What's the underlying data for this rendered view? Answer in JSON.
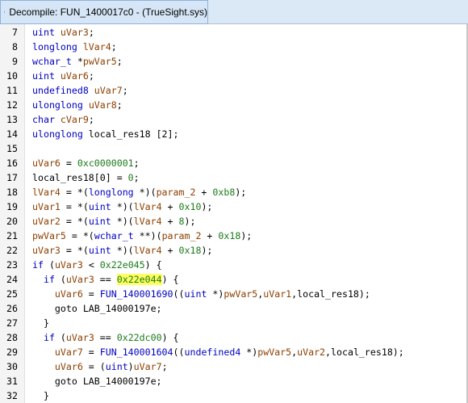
{
  "window": {
    "title": "Decompile: FUN_1400017c0 -  (TrueSight.sys)",
    "icon": "decompile-icon",
    "accent": "#dbe8f6"
  },
  "code_lines": [
    {
      "num": "7",
      "tokens": [
        {
          "t": "uint",
          "c": "kw"
        },
        {
          "t": " ",
          "c": "op"
        },
        {
          "t": "uVar3",
          "c": "id"
        },
        {
          "t": ";",
          "c": "op"
        }
      ]
    },
    {
      "num": "8",
      "tokens": [
        {
          "t": "longlong",
          "c": "kw"
        },
        {
          "t": " ",
          "c": "op"
        },
        {
          "t": "lVar4",
          "c": "id"
        },
        {
          "t": ";",
          "c": "op"
        }
      ]
    },
    {
      "num": "9",
      "tokens": [
        {
          "t": "wchar_t",
          "c": "kw"
        },
        {
          "t": " *",
          "c": "op"
        },
        {
          "t": "pwVar5",
          "c": "id"
        },
        {
          "t": ";",
          "c": "op"
        }
      ]
    },
    {
      "num": "10",
      "tokens": [
        {
          "t": "uint",
          "c": "kw"
        },
        {
          "t": " ",
          "c": "op"
        },
        {
          "t": "uVar6",
          "c": "id"
        },
        {
          "t": ";",
          "c": "op"
        }
      ]
    },
    {
      "num": "11",
      "tokens": [
        {
          "t": "undefined8",
          "c": "kw"
        },
        {
          "t": " ",
          "c": "op"
        },
        {
          "t": "uVar7",
          "c": "id"
        },
        {
          "t": ";",
          "c": "op"
        }
      ]
    },
    {
      "num": "12",
      "tokens": [
        {
          "t": "ulonglong",
          "c": "kw"
        },
        {
          "t": " ",
          "c": "op"
        },
        {
          "t": "uVar8",
          "c": "id"
        },
        {
          "t": ";",
          "c": "op"
        }
      ]
    },
    {
      "num": "13",
      "tokens": [
        {
          "t": "char",
          "c": "kw"
        },
        {
          "t": " ",
          "c": "op"
        },
        {
          "t": "cVar9",
          "c": "id"
        },
        {
          "t": ";",
          "c": "op"
        }
      ]
    },
    {
      "num": "14",
      "tokens": [
        {
          "t": "ulonglong",
          "c": "kw"
        },
        {
          "t": " local_res18 [2];",
          "c": "op"
        }
      ]
    },
    {
      "num": "15",
      "tokens": []
    },
    {
      "num": "16",
      "tokens": [
        {
          "t": "uVar6",
          "c": "id"
        },
        {
          "t": " = ",
          "c": "op"
        },
        {
          "t": "0xc0000001",
          "c": "num"
        },
        {
          "t": ";",
          "c": "op"
        }
      ]
    },
    {
      "num": "17",
      "tokens": [
        {
          "t": "local_res18[0] = ",
          "c": "op"
        },
        {
          "t": "0",
          "c": "num"
        },
        {
          "t": ";",
          "c": "op"
        }
      ]
    },
    {
      "num": "18",
      "tokens": [
        {
          "t": "lVar4",
          "c": "id"
        },
        {
          "t": " = *(",
          "c": "op"
        },
        {
          "t": "longlong",
          "c": "kw"
        },
        {
          "t": " *)(",
          "c": "op"
        },
        {
          "t": "param_2",
          "c": "id"
        },
        {
          "t": " + ",
          "c": "op"
        },
        {
          "t": "0xb8",
          "c": "num"
        },
        {
          "t": ");",
          "c": "op"
        }
      ]
    },
    {
      "num": "19",
      "tokens": [
        {
          "t": "uVar1",
          "c": "id"
        },
        {
          "t": " = *(",
          "c": "op"
        },
        {
          "t": "uint",
          "c": "kw"
        },
        {
          "t": " *)(",
          "c": "op"
        },
        {
          "t": "lVar4",
          "c": "id"
        },
        {
          "t": " + ",
          "c": "op"
        },
        {
          "t": "0x10",
          "c": "num"
        },
        {
          "t": ");",
          "c": "op"
        }
      ]
    },
    {
      "num": "20",
      "tokens": [
        {
          "t": "uVar2",
          "c": "id"
        },
        {
          "t": " = *(",
          "c": "op"
        },
        {
          "t": "uint",
          "c": "kw"
        },
        {
          "t": " *)(",
          "c": "op"
        },
        {
          "t": "lVar4",
          "c": "id"
        },
        {
          "t": " + ",
          "c": "op"
        },
        {
          "t": "8",
          "c": "num"
        },
        {
          "t": ");",
          "c": "op"
        }
      ]
    },
    {
      "num": "21",
      "tokens": [
        {
          "t": "pwVar5",
          "c": "id"
        },
        {
          "t": " = *(",
          "c": "op"
        },
        {
          "t": "wchar_t",
          "c": "kw"
        },
        {
          "t": " **)(",
          "c": "op"
        },
        {
          "t": "param_2",
          "c": "id"
        },
        {
          "t": " + ",
          "c": "op"
        },
        {
          "t": "0x18",
          "c": "num"
        },
        {
          "t": ");",
          "c": "op"
        }
      ]
    },
    {
      "num": "22",
      "tokens": [
        {
          "t": "uVar3",
          "c": "id"
        },
        {
          "t": " = *(",
          "c": "op"
        },
        {
          "t": "uint",
          "c": "kw"
        },
        {
          "t": " *)(",
          "c": "op"
        },
        {
          "t": "lVar4",
          "c": "id"
        },
        {
          "t": " + ",
          "c": "op"
        },
        {
          "t": "0x18",
          "c": "num"
        },
        {
          "t": ");",
          "c": "op"
        }
      ]
    },
    {
      "num": "23",
      "tokens": [
        {
          "t": "if",
          "c": "kw"
        },
        {
          "t": " (",
          "c": "op"
        },
        {
          "t": "uVar3",
          "c": "id"
        },
        {
          "t": " < ",
          "c": "op"
        },
        {
          "t": "0x22e045",
          "c": "num"
        },
        {
          "t": ") {",
          "c": "op"
        }
      ]
    },
    {
      "num": "24",
      "tokens": [
        {
          "t": "  ",
          "c": "op"
        },
        {
          "t": "if",
          "c": "kw"
        },
        {
          "t": " (",
          "c": "op"
        },
        {
          "t": "uVar3",
          "c": "id"
        },
        {
          "t": " == ",
          "c": "op"
        },
        {
          "t": "0x22e044",
          "c": "num",
          "hl": true
        },
        {
          "t": ") {",
          "c": "op"
        }
      ]
    },
    {
      "num": "25",
      "tokens": [
        {
          "t": "    ",
          "c": "op"
        },
        {
          "t": "uVar6",
          "c": "id"
        },
        {
          "t": " = ",
          "c": "op"
        },
        {
          "t": "FUN_140001690",
          "c": "fn"
        },
        {
          "t": "((",
          "c": "op"
        },
        {
          "t": "uint",
          "c": "kw"
        },
        {
          "t": " *)",
          "c": "op"
        },
        {
          "t": "pwVar5",
          "c": "id"
        },
        {
          "t": ",",
          "c": "op"
        },
        {
          "t": "uVar1",
          "c": "id"
        },
        {
          "t": ",local_res18);",
          "c": "op"
        }
      ]
    },
    {
      "num": "26",
      "tokens": [
        {
          "t": "    goto LAB_14000197e;",
          "c": "op"
        }
      ]
    },
    {
      "num": "27",
      "tokens": [
        {
          "t": "  }",
          "c": "op"
        }
      ]
    },
    {
      "num": "28",
      "tokens": [
        {
          "t": "  ",
          "c": "op"
        },
        {
          "t": "if",
          "c": "kw"
        },
        {
          "t": " (",
          "c": "op"
        },
        {
          "t": "uVar3",
          "c": "id"
        },
        {
          "t": " == ",
          "c": "op"
        },
        {
          "t": "0x22dc00",
          "c": "num"
        },
        {
          "t": ") {",
          "c": "op"
        }
      ]
    },
    {
      "num": "29",
      "tokens": [
        {
          "t": "    ",
          "c": "op"
        },
        {
          "t": "uVar7",
          "c": "id"
        },
        {
          "t": " = ",
          "c": "op"
        },
        {
          "t": "FUN_140001604",
          "c": "fn"
        },
        {
          "t": "((",
          "c": "op"
        },
        {
          "t": "undefined4",
          "c": "kw"
        },
        {
          "t": " *)",
          "c": "op"
        },
        {
          "t": "pwVar5",
          "c": "id"
        },
        {
          "t": ",",
          "c": "op"
        },
        {
          "t": "uVar2",
          "c": "id"
        },
        {
          "t": ",local_res18);",
          "c": "op"
        }
      ]
    },
    {
      "num": "30",
      "tokens": [
        {
          "t": "    ",
          "c": "op"
        },
        {
          "t": "uVar6",
          "c": "id"
        },
        {
          "t": " = (",
          "c": "op"
        },
        {
          "t": "uint",
          "c": "kw"
        },
        {
          "t": ")",
          "c": "op"
        },
        {
          "t": "uVar7",
          "c": "id"
        },
        {
          "t": ";",
          "c": "op"
        }
      ]
    },
    {
      "num": "31",
      "tokens": [
        {
          "t": "    goto LAB_14000197e;",
          "c": "op"
        }
      ]
    },
    {
      "num": "32",
      "tokens": [
        {
          "t": "  }",
          "c": "op"
        }
      ]
    }
  ]
}
